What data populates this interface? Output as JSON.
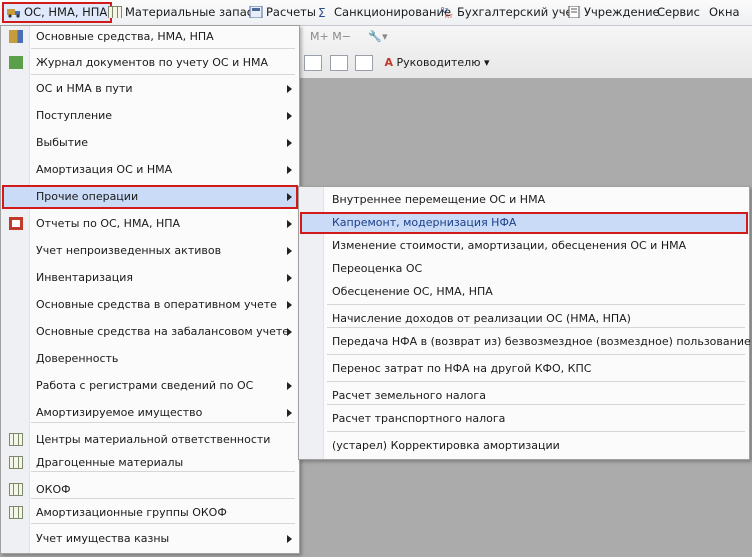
{
  "menubar": {
    "items": [
      {
        "label": "ОС, НМА, НПА",
        "icon": "truck-icon"
      },
      {
        "label": "Материальные запасы",
        "icon": "grid-icon"
      },
      {
        "label": "Расчеты",
        "icon": "calculator-icon"
      },
      {
        "label": "Санкционирование",
        "icon": "sum-icon"
      },
      {
        "label": "Бухгалтерский учет",
        "icon": "dt-kt-icon"
      },
      {
        "label": "Учреждение",
        "icon": "document-icon"
      },
      {
        "label": "Сервис",
        "icon": ""
      },
      {
        "label": "Окна",
        "icon": ""
      }
    ]
  },
  "toolbar": {
    "row1": "M+ M−",
    "manager_label": "Руководителю"
  },
  "main_menu": {
    "items": [
      {
        "label": "Основные средства, НМА, НПА",
        "icon": "truck-icon",
        "submenu": false
      },
      {
        "label": "Журнал документов по учету ОС и НМА",
        "icon": "journal-icon",
        "submenu": false
      },
      {
        "label": "ОС и НМА в пути",
        "icon": "",
        "submenu": true
      },
      {
        "label": "Поступление",
        "icon": "",
        "submenu": true
      },
      {
        "label": "Выбытие",
        "icon": "",
        "submenu": true
      },
      {
        "label": "Амортизация ОС и НМА",
        "icon": "",
        "submenu": true
      },
      {
        "label": "Прочие операции",
        "icon": "",
        "submenu": true
      },
      {
        "label": "Отчеты по ОС, НМА, НПА",
        "icon": "report-icon",
        "submenu": true
      },
      {
        "label": "Учет непроизведенных активов",
        "icon": "",
        "submenu": true
      },
      {
        "label": "Инвентаризация",
        "icon": "",
        "submenu": true
      },
      {
        "label": "Основные средства в оперативном учете",
        "icon": "",
        "submenu": true
      },
      {
        "label": "Основные средства на забалансовом учете",
        "icon": "",
        "submenu": true
      },
      {
        "label": "Доверенность",
        "icon": "",
        "submenu": false
      },
      {
        "label": "Работа с регистрами сведений по ОС",
        "icon": "",
        "submenu": true
      },
      {
        "label": "Амортизируемое имущество",
        "icon": "",
        "submenu": true
      },
      {
        "label": "Центры материальной ответственности",
        "icon": "grid-icon",
        "submenu": false
      },
      {
        "label": "Драгоценные материалы",
        "icon": "grid-icon",
        "submenu": false
      },
      {
        "label": "ОКОФ",
        "icon": "grid-icon",
        "submenu": false
      },
      {
        "label": "Амортизационные группы ОКОФ",
        "icon": "table-icon",
        "submenu": false
      },
      {
        "label": "Учет имущества казны",
        "icon": "",
        "submenu": true
      }
    ]
  },
  "submenu": {
    "items": [
      "Внутреннее перемещение ОС и НМА",
      "Капремонт, модернизация НФА",
      "Изменение стоимости, амортизации, обесценения ОС и НМА",
      "Переоценка ОС",
      "Обесценение ОС, НМА, НПА",
      "Начисление доходов от реализации ОС (НМА, НПА)",
      "Передача НФА в (возврат из) безвозмездное (возмездное) пользование",
      "Перенос затрат по НФА на другой КФО, КПС",
      "Расчет земельного налога",
      "Расчет транспортного налога",
      "(устарел) Корректировка амортизации"
    ]
  },
  "colors": {
    "highlight_border": "#d11a1a",
    "highlight_fill": "#c9dbf7",
    "background": "#ababab"
  }
}
